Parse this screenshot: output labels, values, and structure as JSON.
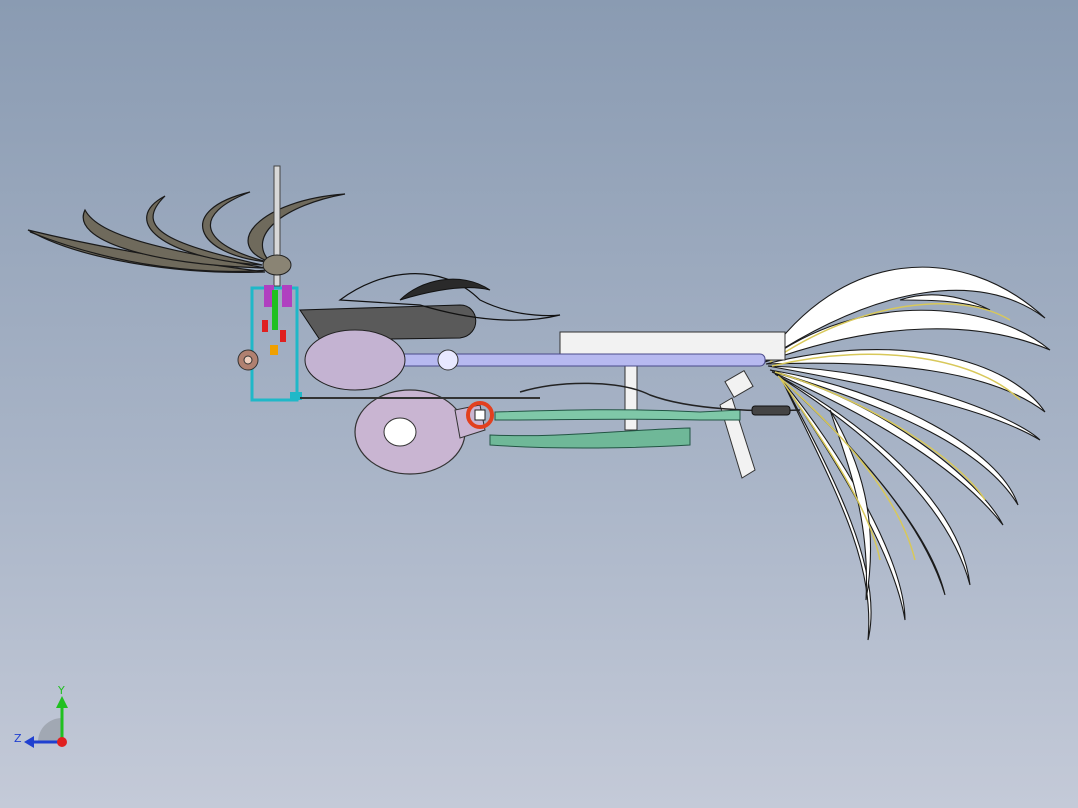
{
  "viewport": {
    "background_top": "#8a9bb2",
    "background_bottom": "#c4cad8"
  },
  "model": {
    "description_icon": "cad-assembly-icon",
    "feather_white": "#ffffff",
    "feather_dark": "#6f6a5c",
    "accent_yellow": "#d8c85a",
    "rod_color": "#b7b9f0",
    "pump_color": "#c9b5d2",
    "hose_color": "#7fc8a8",
    "ring_color": "#e2401f",
    "frame_color": "#1fb8c8"
  },
  "triad": {
    "y_label": "Y",
    "z_label": "Z",
    "x_color": "#e02020",
    "y_color": "#20c020",
    "z_color": "#2040d0"
  }
}
